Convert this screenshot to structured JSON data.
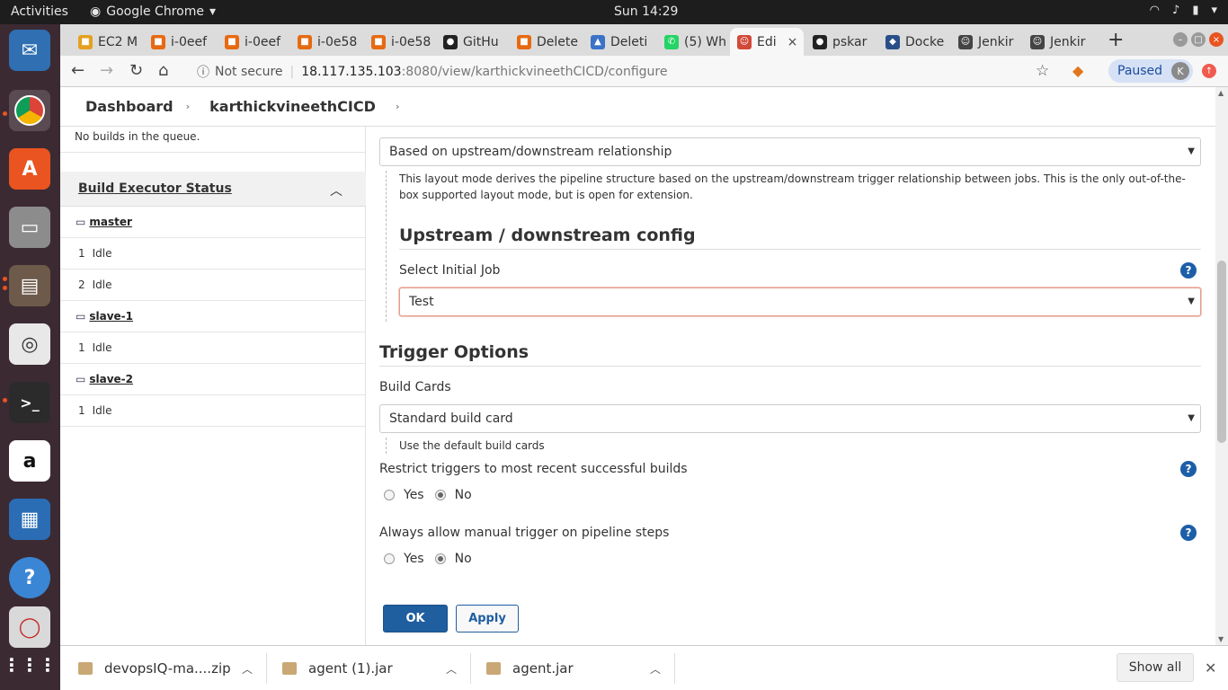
{
  "os": {
    "activities": "Activities",
    "app_name": "Google Chrome",
    "clock": "Sun 14:29"
  },
  "tabs": [
    {
      "label": "EC2 M",
      "icon": "aws-cube-icon",
      "color": "#e5a021"
    },
    {
      "label": "i-0eef",
      "icon": "aws-cube-icon",
      "color": "#e66a12"
    },
    {
      "label": "i-0eef",
      "icon": "aws-cube-icon",
      "color": "#e66a12"
    },
    {
      "label": "i-0e58",
      "icon": "aws-cube-icon",
      "color": "#e66a12"
    },
    {
      "label": "i-0e58",
      "icon": "aws-cube-icon",
      "color": "#e66a12"
    },
    {
      "label": "GitHu",
      "icon": "github-icon",
      "color": "#222222"
    },
    {
      "label": "Delete",
      "icon": "aws-cube-icon",
      "color": "#e66a12"
    },
    {
      "label": "Deleti",
      "icon": "aws-s3-icon",
      "color": "#3b73c8"
    },
    {
      "label": "(5) Wh",
      "icon": "whatsapp-icon",
      "color": "#25d366"
    },
    {
      "label": "Edi",
      "icon": "jenkins-icon",
      "color": "#d24939",
      "active": true
    },
    {
      "label": "pskar",
      "icon": "github-icon",
      "color": "#222222"
    },
    {
      "label": "Docke",
      "icon": "docker-icon",
      "color": "#2a4f88"
    },
    {
      "label": "Jenkir",
      "icon": "jenkins-icon",
      "color": "#444444"
    },
    {
      "label": "Jenkir",
      "icon": "jenkins-icon",
      "color": "#444444"
    }
  ],
  "omnibox": {
    "security": "Not secure",
    "host": "18.117.135.103",
    "path": ":8080/view/karthickvineethCICD/configure",
    "paused": "Paused",
    "avatar": "K"
  },
  "breadcrumb": {
    "dashboard": "Dashboard",
    "view": "karthickvineethCICD"
  },
  "sidebar": {
    "queue": "No builds in the queue.",
    "executor_title": "Build Executor Status",
    "nodes": [
      {
        "name": "master",
        "executors": [
          {
            "num": "1",
            "state": "Idle"
          },
          {
            "num": "2",
            "state": "Idle"
          }
        ]
      },
      {
        "name": "slave-1",
        "executors": [
          {
            "num": "1",
            "state": "Idle"
          }
        ]
      },
      {
        "name": "slave-2",
        "executors": [
          {
            "num": "1",
            "state": "Idle"
          }
        ]
      }
    ]
  },
  "main": {
    "layout_select": "Based on upstream/downstream relationship",
    "layout_desc": "This layout mode derives the pipeline structure based on the upstream/downstream trigger relationship between jobs. This is the only out-of-the-box supported layout mode, but is open for extension.",
    "upstream_heading": "Upstream / downstream config",
    "initial_job_label": "Select Initial Job",
    "initial_job_value": "Test",
    "trigger_heading": "Trigger Options",
    "build_cards_label": "Build Cards",
    "build_cards_value": "Standard build card",
    "build_cards_desc": "Use the default build cards",
    "restrict_label": "Restrict triggers to most recent successful builds",
    "manual_label": "Always allow manual trigger on pipeline steps",
    "yes": "Yes",
    "no": "No",
    "ok": "OK",
    "apply": "Apply"
  },
  "downloads": {
    "items": [
      "devopsIQ-ma....zip",
      "agent (1).jar",
      "agent.jar"
    ],
    "show_all": "Show all"
  }
}
